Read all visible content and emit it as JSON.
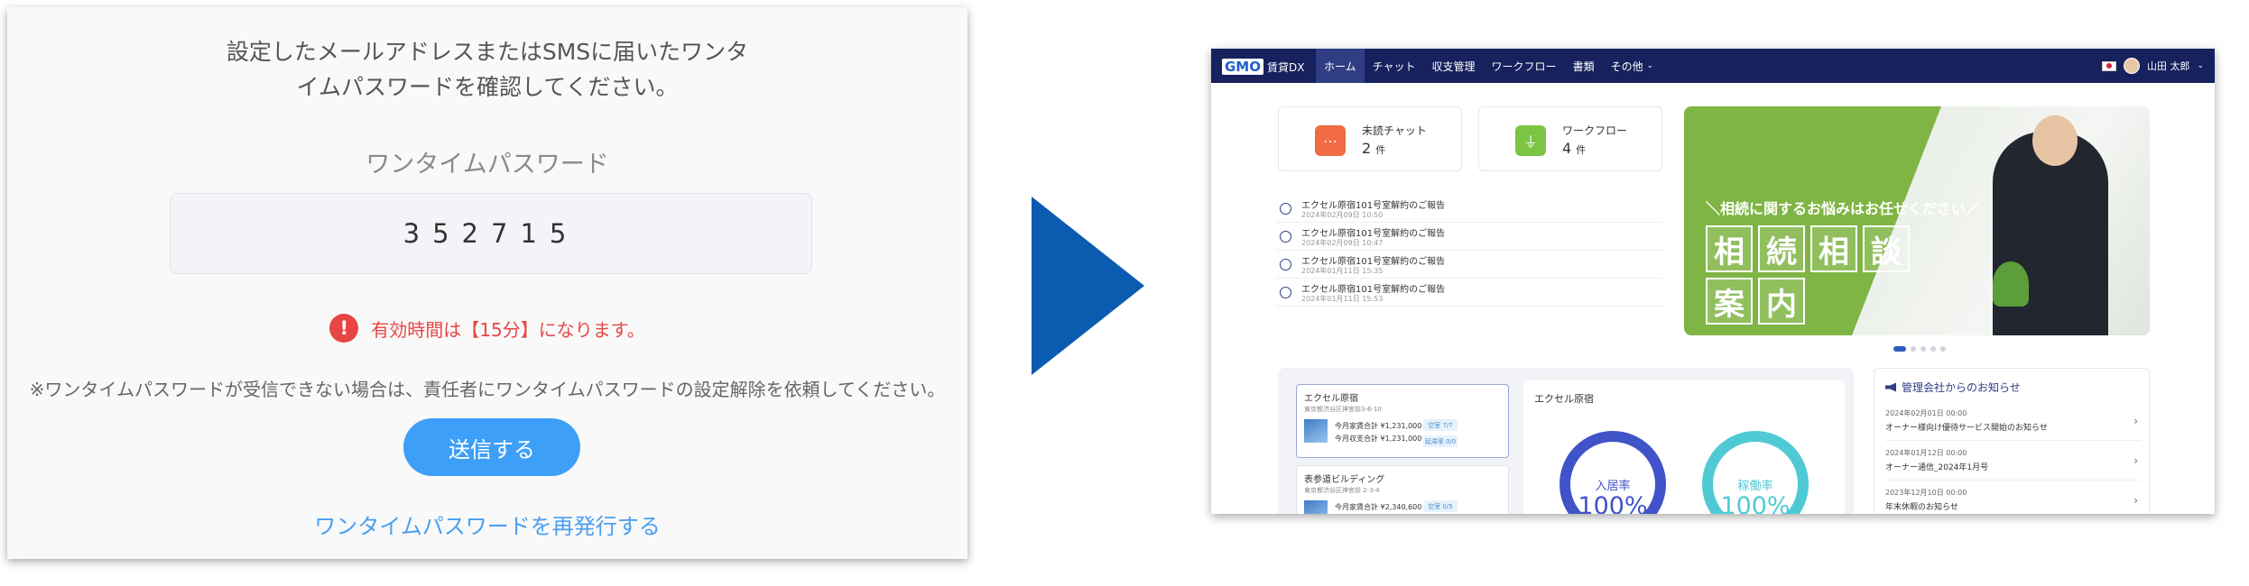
{
  "otp": {
    "instruction_line1": "設定したメールアドレスまたはSMSに届いたワンタ",
    "instruction_line2": "イムパスワードを確認してください。",
    "label": "ワンタイムパスワード",
    "value": "352715",
    "notice": "有効時間は【15分】になります。",
    "help": "※ワンタイムパスワードが受信できない場合は、責任者にワンタイムパスワードの設定解除を依頼してください。",
    "submit_label": "送信する",
    "reissue_label": "ワンタイムパスワードを再発行する"
  },
  "colors": {
    "accent": "#3d9ff7",
    "warning": "#e94545",
    "arrow": "#0b5cb1",
    "nav": "#16215d"
  },
  "app": {
    "logo_main": "GMO",
    "logo_sub": "賃貸DX",
    "nav": [
      "ホーム",
      "チャット",
      "収支管理",
      "ワークフロー",
      "書類",
      "その他"
    ],
    "user_name": "山田 太郎",
    "summary": [
      {
        "title": "未読チャット",
        "count": "2",
        "unit": "件",
        "icon": "chat-bubble-icon"
      },
      {
        "title": "ワークフロー",
        "count": "4",
        "unit": "件",
        "icon": "stamp-icon"
      }
    ],
    "messages": [
      {
        "title": "エクセル原宿101号室解約のご報告",
        "date": "2024年02月09日 10:50"
      },
      {
        "title": "エクセル原宿101号室解約のご報告",
        "date": "2024年02月09日 10:47"
      },
      {
        "title": "エクセル原宿101号室解約のご報告",
        "date": "2024年01月11日 15:35"
      },
      {
        "title": "エクセル原宿101号室解約のご報告",
        "date": "2024年01月11日 15:53"
      }
    ],
    "banner": {
      "tagline": "＼相続に関するお悩みはお任せください／",
      "kanji_row1": [
        "相",
        "続",
        "相",
        "談"
      ],
      "kanji_row2": [
        "案",
        "内"
      ]
    },
    "properties": [
      {
        "name": "エクセル原宿",
        "address": "東京都渋谷区神宮前3-6-10",
        "m1": "今月家賃合計 ¥1,231,000",
        "m2": "今月収支合計 ¥1,231,000",
        "tag1": "空室 7/7",
        "tag2": "延滞率 0/0"
      },
      {
        "name": "表参道ビルディング",
        "address": "東京都渋谷区神宮前 2-3-4",
        "m1": "今月家賃合計 ¥2,340,600",
        "m2": "",
        "tag1": "空室 0/5",
        "tag2": ""
      }
    ],
    "chart_title": "エクセル原宿",
    "gauges": [
      {
        "label": "入居率",
        "value": "100%"
      },
      {
        "label": "稼働率",
        "value": "100%"
      }
    ],
    "notices_title": "管理会社からのお知らせ",
    "notices": [
      {
        "date": "2024年02月01日 00:00",
        "title": "オーナー様向け優待サービス開始のお知らせ"
      },
      {
        "date": "2024年01月12日 00:00",
        "title": "オーナー通信_2024年1月号"
      },
      {
        "date": "2023年12月10日 00:00",
        "title": "年末休暇のお知らせ"
      }
    ]
  }
}
